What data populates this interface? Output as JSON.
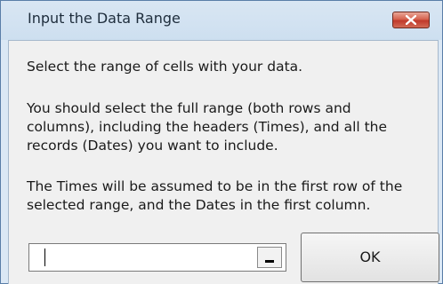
{
  "window": {
    "title": "Input the Data Range",
    "close_icon": "close-icon"
  },
  "content": {
    "instruction": "Select the range of cells with your data.",
    "paragraph1": [
      "You should select the full range (both rows and",
      "columns), including the headers (Times), and all the",
      "records (Dates) you want to include."
    ],
    "paragraph2": [
      "The Times will be assumed to be in the first row of the",
      "selected range, and the Dates in the first column."
    ]
  },
  "range_input": {
    "value": "",
    "collapse_icon": "collapse-dialog-icon"
  },
  "buttons": {
    "ok_label": "OK"
  },
  "colors": {
    "close_button": "#c0392b",
    "titlebar": "#d9e6f3",
    "client_background": "#f0f0f0"
  }
}
